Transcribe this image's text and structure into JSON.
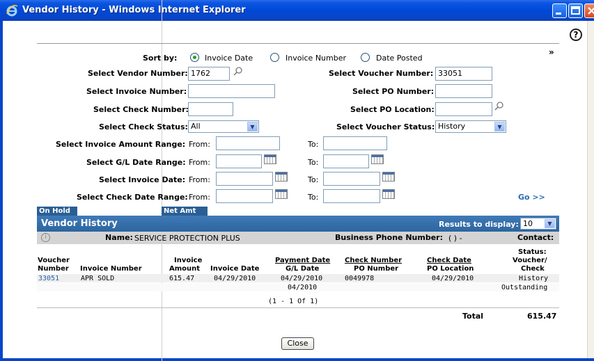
{
  "window": {
    "title": "Vendor History - Windows Internet Explorer"
  },
  "form": {
    "sort_by_label": "Sort by:",
    "sort_options": [
      "Invoice Date",
      "Invoice Number",
      "Date Posted"
    ],
    "vendor_number_label": "Select Vendor Number:",
    "vendor_number_value": "1762",
    "voucher_number_label": "Select Voucher Number:",
    "voucher_number_value": "33051",
    "invoice_number_label": "Select Invoice Number:",
    "invoice_number_value": "",
    "po_number_label": "Select PO Number:",
    "po_number_value": "",
    "check_number_label": "Select Check Number:",
    "check_number_value": "",
    "po_location_label": "Select PO Location:",
    "po_location_value": "",
    "check_status_label": "Select Check Status:",
    "check_status_value": "All",
    "voucher_status_label": "Select Voucher Status:",
    "voucher_status_value": "History",
    "invoice_amount_label": "Select Invoice Amount Range:",
    "gl_date_label": "Select G/L Date Range:",
    "invoice_date_label": "Select Invoice Date:",
    "check_date_label": "Select Check Date Range:",
    "from_label": "From:",
    "to_label": "To:",
    "go_label": "Go >>",
    "expand_label": "»"
  },
  "tabs": {
    "on_hold": "On Hold",
    "net_amt": "Net Amt"
  },
  "history": {
    "title": "Vendor History",
    "results_label": "Results to display:",
    "results_value": "10",
    "name_label": "Name:",
    "name_value": "SERVICE PROTECTION PLUS",
    "phone_label": "Business Phone Number:",
    "phone_value": "( ) -",
    "contact_label": "Contact:",
    "headers": {
      "voucher": "Voucher",
      "number": "Number",
      "invoice_number": "Invoice Number",
      "invoice": "Invoice",
      "amount": "Amount",
      "invoice_date": "Invoice Date",
      "payment_date": "Payment Date",
      "gl_date": "G/L Date",
      "check_number": "Check Number",
      "po_number": "PO Number",
      "check_date": "Check Date",
      "po_location": "PO Location",
      "status": "Status:",
      "voucher_slash": "Voucher/",
      "check": "Check"
    },
    "row": {
      "voucher": "33051",
      "invoice_number": "APR SOLD",
      "amount": "615.47",
      "invoice_date": "04/29/2010",
      "payment_date": "04/29/2010",
      "gl_date": "04/2010",
      "check_number": "0049978",
      "check_date": "04/29/2010",
      "status_voucher": "History",
      "status_check": "Outstanding"
    },
    "paging": "(1 - 1 Of 1)",
    "total_label": "Total",
    "total_value": "615.47"
  },
  "close_label": "Close",
  "help_label": "?"
}
